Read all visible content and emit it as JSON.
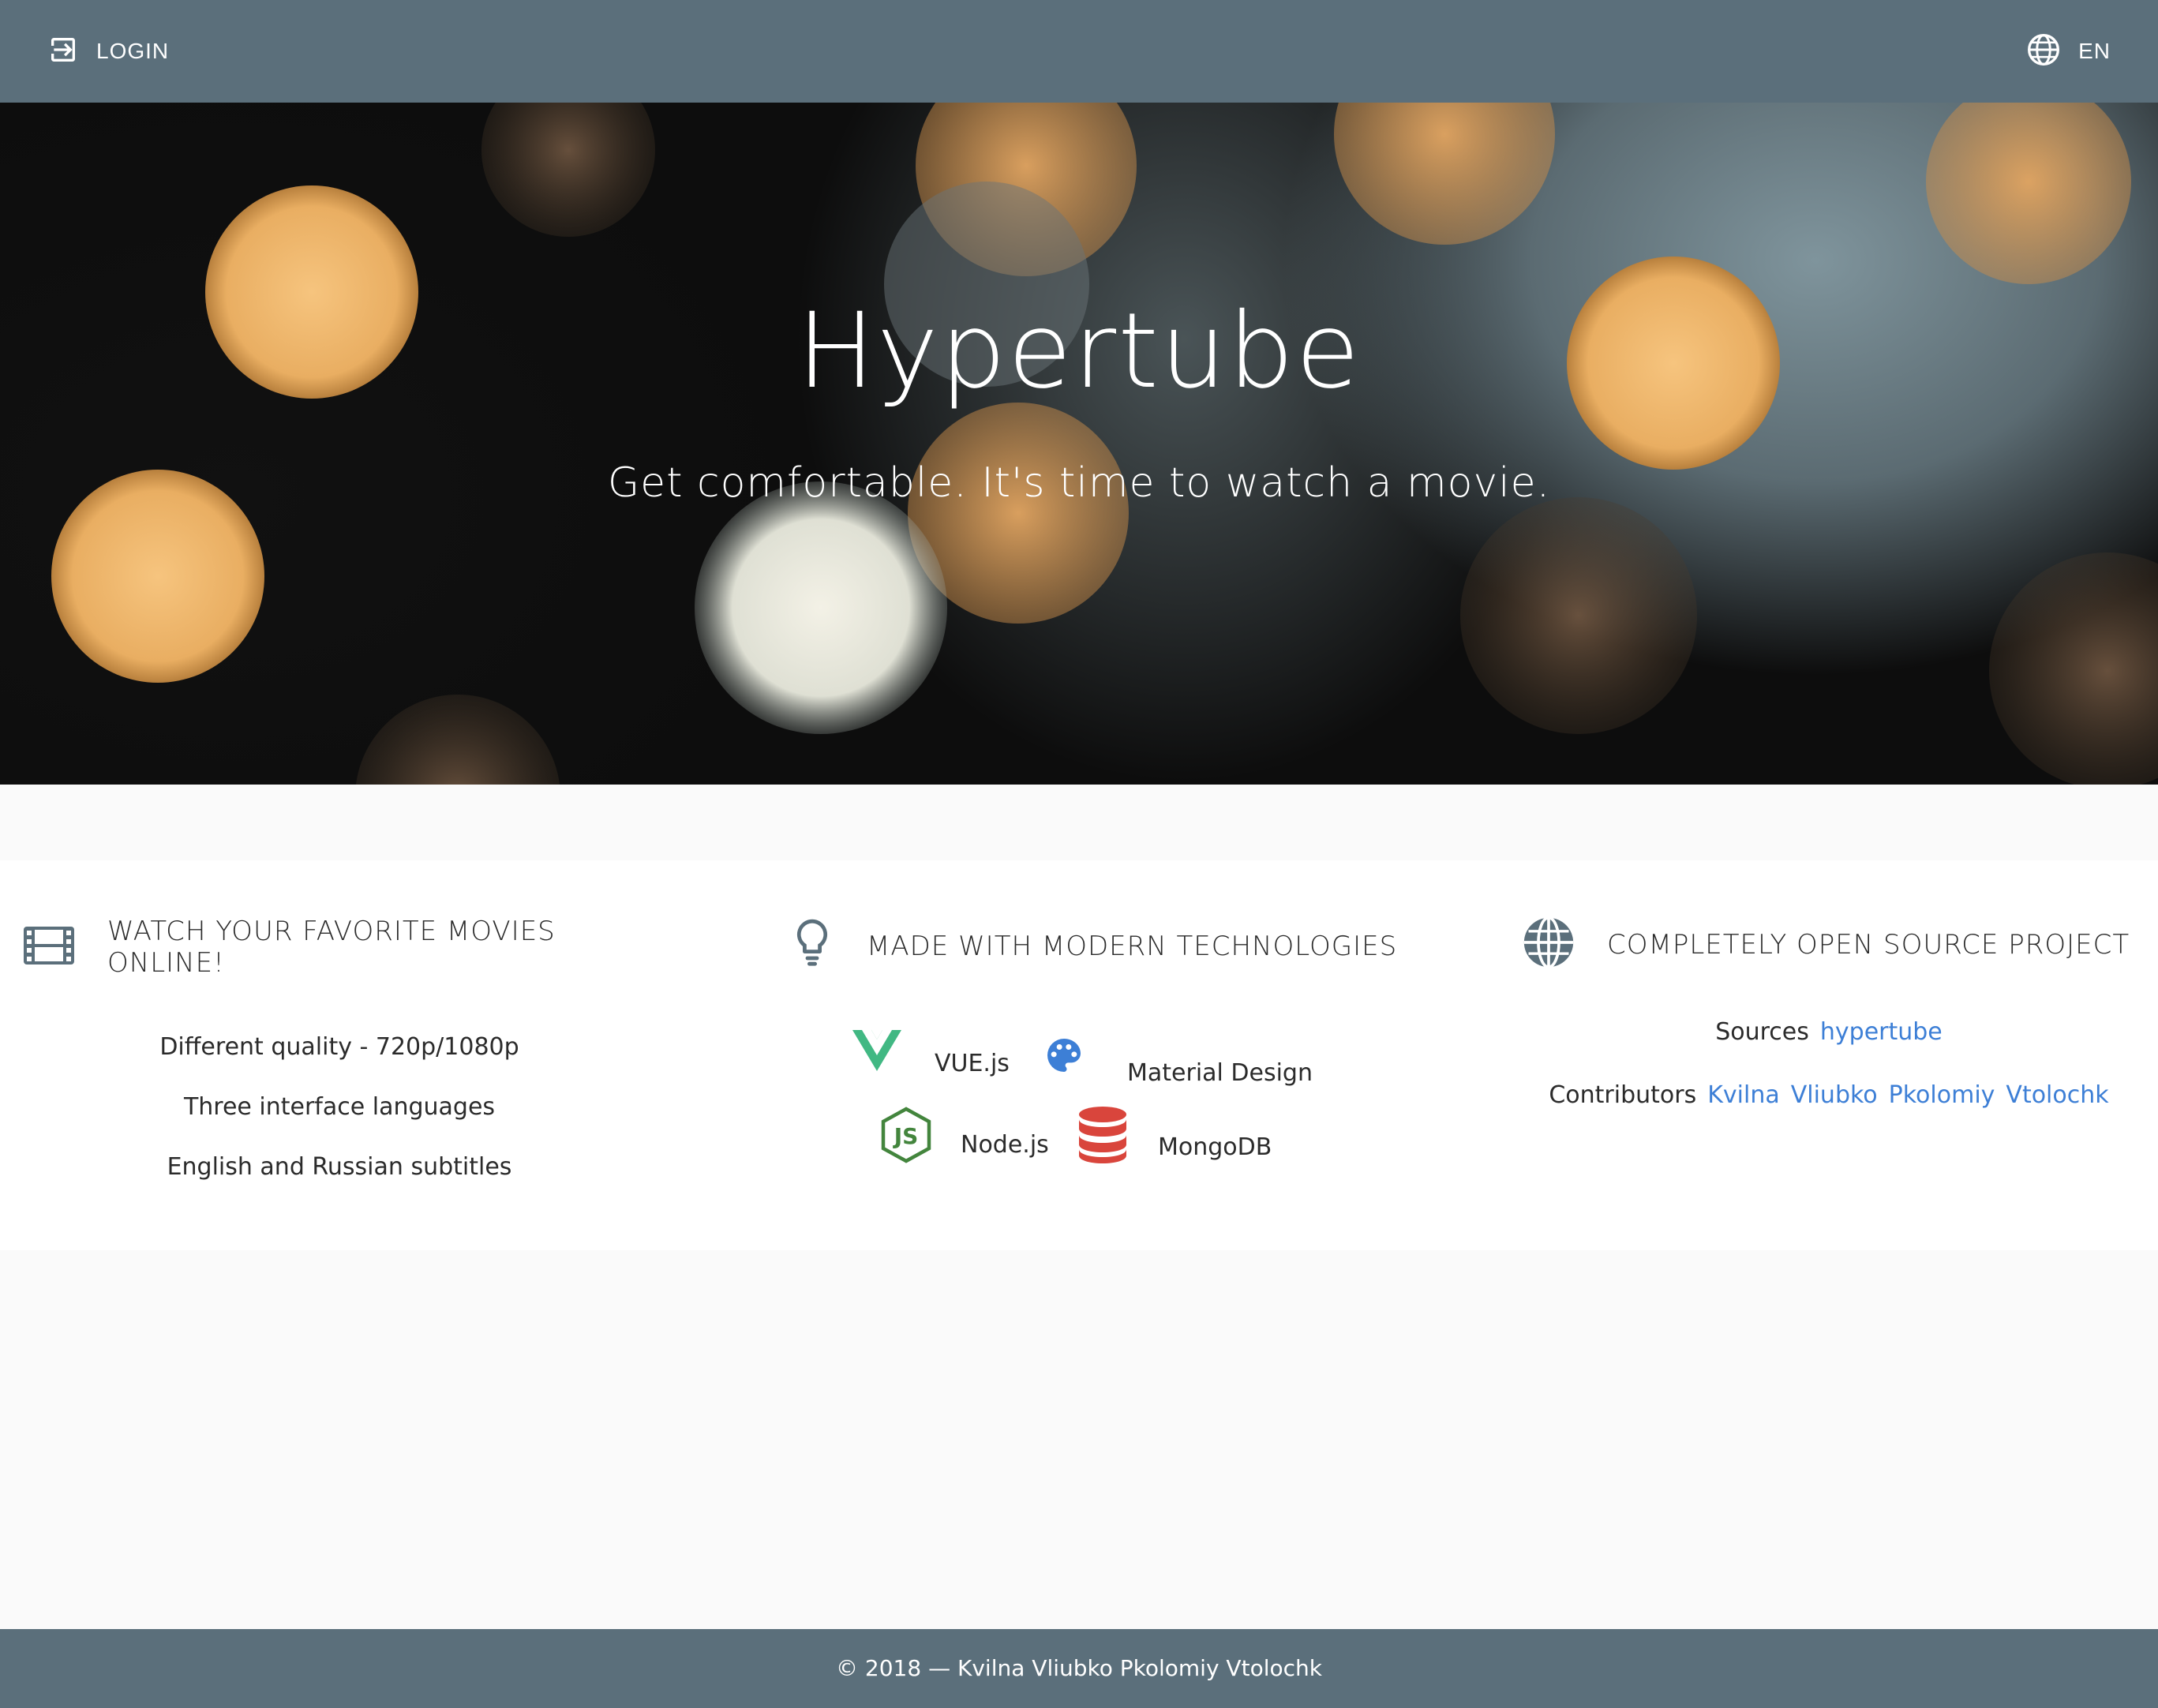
{
  "toolbar": {
    "login_label": "LOGIN",
    "language_label": "EN"
  },
  "hero": {
    "title": "Hypertube",
    "subtitle": "Get comfortable. It's time to watch a movie."
  },
  "features": {
    "watch": {
      "title": "WATCH YOUR FAVORITE MOVIES ONLINE!",
      "icon": "film-icon",
      "items": [
        "Different quality - 720p/1080p",
        "Three interface languages",
        "English and Russian subtitles"
      ]
    },
    "tech": {
      "title": "MADE WITH MODERN TECHNOLOGIES",
      "icon": "lightbulb-icon",
      "items": [
        {
          "label": "VUE.js",
          "icon": "vuejs-icon",
          "color": "#41b883"
        },
        {
          "label": "Material Design",
          "icon": "palette-icon",
          "color": "#3d7fd6"
        },
        {
          "label": "Node.js",
          "icon": "nodejs-icon",
          "color": "#43853d"
        },
        {
          "label": "MongoDB",
          "icon": "database-icon",
          "color": "#d9453c"
        }
      ]
    },
    "open_source": {
      "title": "COMPLETELY OPEN SOURCE PROJECT",
      "icon": "globe-icon",
      "sources_label": "Sources",
      "sources_link": "hypertube",
      "contributors_label": "Contributors",
      "contributors": [
        "Kvilna",
        "Vliubko",
        "Pkolomiy",
        "Vtolochk"
      ]
    }
  },
  "footer": {
    "text": "© 2018 — Kvilna Vliubko Pkolomiy Vtolochk"
  },
  "colors": {
    "toolbar": "#5b6f7b",
    "link": "#3d7fd6",
    "icon_gray": "#5b6f7b"
  }
}
